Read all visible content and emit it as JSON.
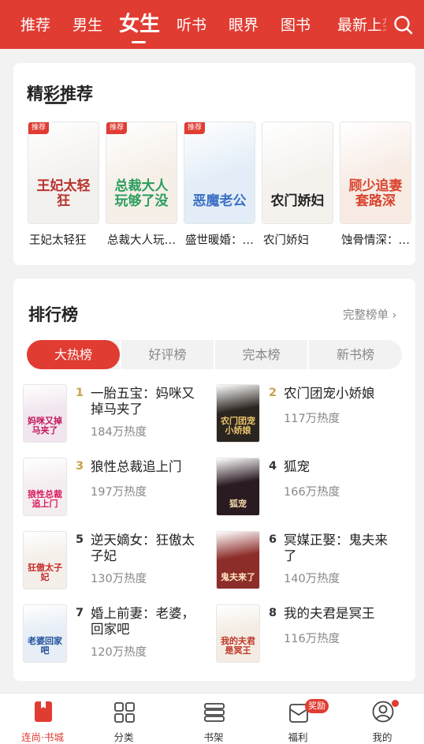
{
  "top_tabs": [
    "推荐",
    "男生",
    "女生",
    "听书",
    "眼界",
    "图书",
    "最新上架"
  ],
  "active_tab": "女生",
  "featured": {
    "title": "精彩推荐",
    "badge_label": "推荐",
    "books": [
      {
        "name": "王妃太轻狂",
        "cover_text": "王妃太轻狂",
        "badge": true,
        "cover_color": "#f3f1ee",
        "text_color": "#b8312f"
      },
      {
        "name": "总裁大人玩够了没",
        "cover_text": "总裁大人玩够了没",
        "badge": true,
        "cover_color": "#f6efe8",
        "text_color": "#2a9d5c"
      },
      {
        "name": "盛世暖婚：恶魔老公",
        "cover_text": "恶魔老公",
        "badge": true,
        "cover_color": "#e2edf7",
        "text_color": "#3a6fc4"
      },
      {
        "name": "农门娇妇",
        "cover_text": "农门娇妇",
        "badge": false,
        "cover_color": "#f5f2ee",
        "text_color": "#222222"
      },
      {
        "name": "蚀骨情深：顾少追妻套路深",
        "cover_text": "顾少追妻套路深",
        "badge": false,
        "cover_color": "#f7ebe4",
        "text_color": "#d8452f"
      }
    ]
  },
  "ranking": {
    "title": "排行榜",
    "full_list_label": "完整榜单 ›",
    "tabs": [
      "大热榜",
      "好评榜",
      "完本榜",
      "新书榜"
    ],
    "active_tab": "大热榜",
    "items": [
      {
        "rank": "1",
        "title": "一胎五宝：妈咪又掉马夹了",
        "heat": "184万热度",
        "cover_text": "妈咪又掉马夹了",
        "cover_color": "#f1e6ef",
        "text_color": "#c2185b"
      },
      {
        "rank": "2",
        "title": "农门团宠小娇娘",
        "heat": "117万热度",
        "cover_text": "农门团宠小娇娘",
        "cover_color": "#2b2520",
        "text_color": "#e9c46a"
      },
      {
        "rank": "3",
        "title": "狼性总裁追上门",
        "heat": "197万热度",
        "cover_text": "狼性总裁追上门",
        "cover_color": "#f5eef0",
        "text_color": "#d81b60"
      },
      {
        "rank": "4",
        "title": "狐宠",
        "heat": "166万热度",
        "cover_text": "狐宠",
        "cover_color": "#2a1a22",
        "text_color": "#f0d9a8"
      },
      {
        "rank": "5",
        "title": "逆天嫡女：狂傲太子妃",
        "heat": "130万热度",
        "cover_text": "狂傲太子妃",
        "cover_color": "#f4efe9",
        "text_color": "#c62828"
      },
      {
        "rank": "6",
        "title": "冥媒正娶：鬼夫来了",
        "heat": "140万热度",
        "cover_text": "鬼夫来了",
        "cover_color": "#8d2d2a",
        "text_color": "#ffe7c2"
      },
      {
        "rank": "7",
        "title": "婚上前妻：老婆，回家吧",
        "heat": "120万热度",
        "cover_text": "老婆回家吧",
        "cover_color": "#e7eef6",
        "text_color": "#1e4e9c"
      },
      {
        "rank": "8",
        "title": "我的夫君是冥王",
        "heat": "116万热度",
        "cover_text": "我的夫君是冥王",
        "cover_color": "#f4ece3",
        "text_color": "#c0392b"
      }
    ]
  },
  "rank_colors": {
    "top3": "#c9a24b",
    "rest": "#333333"
  },
  "bottom_nav": [
    {
      "label": "连尚·书城",
      "icon": "book-icon",
      "active": true
    },
    {
      "label": "分类",
      "icon": "grid-icon",
      "active": false
    },
    {
      "label": "书架",
      "icon": "bookshelf-icon",
      "active": false
    },
    {
      "label": "福利",
      "icon": "gift-icon",
      "active": false,
      "badge": "奖励"
    },
    {
      "label": "我的",
      "icon": "user-icon",
      "active": false
    }
  ],
  "accent_color": "#e03c32"
}
